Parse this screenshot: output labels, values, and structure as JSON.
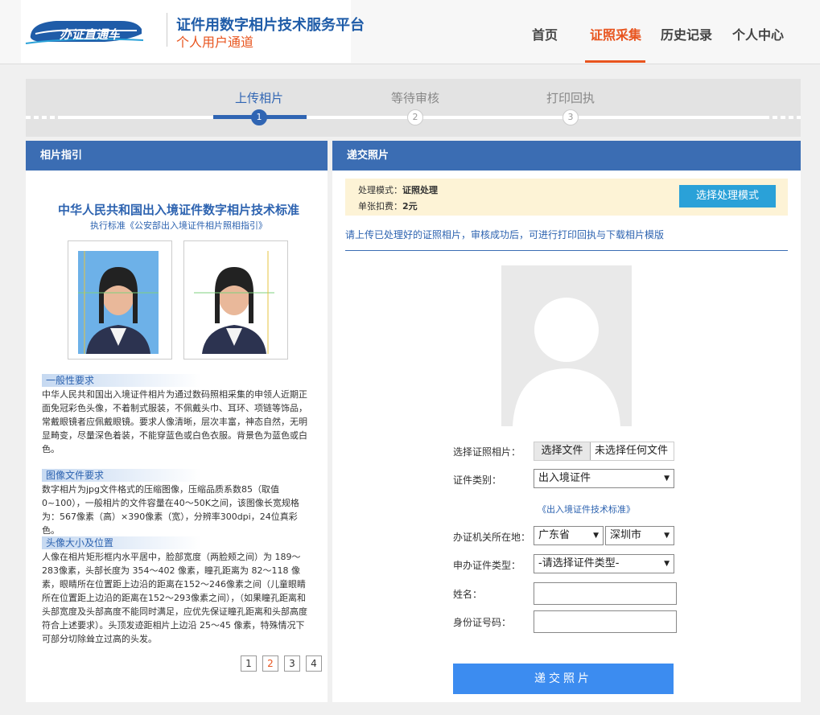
{
  "header": {
    "site_title": "证件用数字相片技术服务平台",
    "site_subtitle": "个人用户通道",
    "nav": [
      "首页",
      "证照采集",
      "历史记录",
      "个人中心"
    ],
    "active_nav": "证照采集",
    "accent_color": "#e8541e",
    "logo_text": "办证直通车"
  },
  "steps": {
    "items": [
      {
        "label": "上传相片",
        "num": "1"
      },
      {
        "label": "等待审核",
        "num": "2"
      },
      {
        "label": "打印回执",
        "num": "3"
      }
    ],
    "current": 1
  },
  "left_panel": {
    "title": "相片指引",
    "guide_title": "中华人民共和国出入境证件数字相片技术标准",
    "guide_subtitle": "执行标准《公安部出入境证件相片照相指引》",
    "sections": [
      {
        "heading": "一般性要求",
        "body": "中华人民共和国出入境证件相片为通过数码照相采集的申领人近期正面免冠彩色头像，不着制式服装，不佩戴头巾、耳环、项链等饰品，常戴眼镜者应佩戴眼镜。要求人像清晰，层次丰富，神态自然，无明显畸变，尽量深色着装，不能穿蓝色或白色衣服。背景色为蓝色或白色。"
      },
      {
        "heading": "图像文件要求",
        "body": "数字相片为jpg文件格式的压缩图像，压缩品质系数85（取值0~100），一般相片的文件容量在40～50K之间，该图像长宽规格为：567像素（高）×390像素（宽），分辨率300dpi，24位真彩色。"
      },
      {
        "heading": "头像大小及位置",
        "body": "人像在相片矩形框内水平居中，脸部宽度（两脸颊之间）为 189～283像素，头部长度为 354～402 像素，瞳孔距离为 82～118 像素，眼睛所在位置距上边沿的距离在152～246像素之间（儿童眼睛所在位置距上边沿的距离在152～293像素之间），（如果瞳孔距离和头部宽度及头部高度不能同时满足，应优先保证瞳孔距离和头部高度符合上述要求）。头顶发迹距相片上边沿 25～45 像素，特殊情况下可部分切除耸立过高的头发。"
      }
    ],
    "pages": [
      "1",
      "2",
      "3",
      "4"
    ],
    "current_page": "2"
  },
  "right_panel": {
    "title": "递交照片",
    "mode_label": "处理模式：",
    "mode_value": "证照处理",
    "fee_label": "单张扣费：",
    "fee_value": "2元",
    "mode_button": "选择处理模式",
    "hint": "请上传已处理好的证照相片，审核成功后，可进行打印回执与下载相片模版",
    "form": {
      "photo_label": "选择证照相片：",
      "file_button": "选择文件",
      "file_status": "未选择任何文件",
      "type_label": "证件类别：",
      "type_value": "出入境证件",
      "standard_link": "《出入境证件技术标准》",
      "location_label": "办证机关所在地：",
      "province": "广东省",
      "city": "深圳市",
      "apply_type_label": "申办证件类型：",
      "apply_type_value": "-请选择证件类型-",
      "name_label": "姓名：",
      "id_label": "身份证号码："
    },
    "submit_label": "递交照片"
  }
}
